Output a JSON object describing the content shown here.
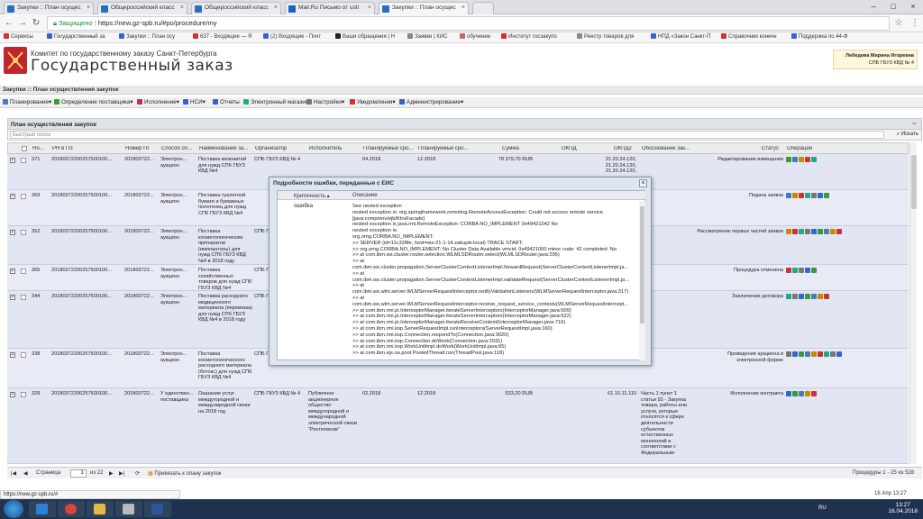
{
  "browser": {
    "tabs": [
      {
        "label": "Закупки :: План осущес",
        "color": "#2d6cc0",
        "active": false
      },
      {
        "label": "Общероссийский класс",
        "color": "#2d6cc0",
        "active": false
      },
      {
        "label": "Общероссийский класс",
        "color": "#2d6cc0",
        "active": false
      },
      {
        "label": "Mail.Ru Письмо от usti",
        "color": "#1a63c6",
        "active": false
      },
      {
        "label": "Закупки :: План осущес",
        "color": "#2d6cc0",
        "active": true
      },
      {
        "label": "",
        "color": "#ddd",
        "active": false
      }
    ],
    "secure_label": "Защищено",
    "url": "https://new.gz-spb.ru/#po/procedure/my",
    "bookmarks": [
      {
        "label": "Сервисы",
        "color": "#c33"
      },
      {
        "label": "Государственный за",
        "color": "#36c"
      },
      {
        "label": "Закупки :: План осу",
        "color": "#36c"
      },
      {
        "label": "637 - Входящие — Я",
        "color": "#c33"
      },
      {
        "label": "(2) Входящие - Почт",
        "color": "#36c"
      },
      {
        "label": "Ваши обращения | Н",
        "color": "#222"
      },
      {
        "label": "Заявки | КИС",
        "color": "#888"
      },
      {
        "label": "обучение",
        "color": "#c66"
      },
      {
        "label": "Институт госзакупо",
        "color": "#c33"
      },
      {
        "label": "Реестр товаров для",
        "color": "#888"
      },
      {
        "label": "НПД «Закон Санкт-П",
        "color": "#36c"
      },
      {
        "label": "Справочник конечн",
        "color": "#c33"
      },
      {
        "label": "Поддержка по 44-Ф",
        "color": "#36c"
      }
    ]
  },
  "site": {
    "subtitle": "Комитет по государственному заказу Санкт-Петербурга",
    "title": "Государственный заказ",
    "user_name": "Лебедева Марина Игоревна",
    "user_org": "СПБ ГБУЗ КВД № 4"
  },
  "breadcrumb": "Закупки :: План осуществления закупок",
  "menu": [
    {
      "label": "Планирование",
      "color": "#4a7bb7"
    },
    {
      "label": "Определение поставщика",
      "color": "#3a9a3a"
    },
    {
      "label": "Исполнение",
      "color": "#b35"
    },
    {
      "label": "НСИ",
      "color": "#36c"
    },
    {
      "label": "Отчеты",
      "color": "#36c"
    },
    {
      "label": "Электронный магазин",
      "color": "#2a8"
    },
    {
      "label": "Настройки",
      "color": "#777"
    },
    {
      "label": "Уведомления",
      "color": "#c33"
    },
    {
      "label": "Администрирование",
      "color": "#36c"
    }
  ],
  "panel": {
    "title": "План осуществления закупок",
    "search_placeholder": "Быстрый поиск",
    "search_button": "Искать"
  },
  "columns": [
    "Но...",
    "РН в ПЗ",
    "Номер ПГ",
    "Способ оп...",
    "Наименование за...",
    "Организатор",
    "Исполнитель",
    "Планируемый сро...",
    "Планируемый сро...",
    "Сумма",
    "ОКПД",
    "ОКПД2",
    "Обоснование зак...",
    "Статус",
    "Операции"
  ],
  "rows": [
    {
      "no": "371",
      "rn": "20180372200257500100...",
      "pg": "201803722...",
      "method": "Электрон... аукцион",
      "name": "Поставка мезонитей для нужд СПб ГБУЗ КВД №4",
      "org": "СПБ ГБУЗ КВД № 4",
      "exec": "",
      "d1": "04.2018",
      "d2": "12.2018",
      "sum": "78 379,70 RUB",
      "okpd": "",
      "okpd2": "21.20.24.120, 21.20.24.120, 21.20.24.120,",
      "reason": "",
      "status": "Редактирование извещения"
    },
    {
      "no": "369",
      "rn": "20180372200257500100...",
      "pg": "201803722...",
      "method": "Электрон... аукцион",
      "name": "Поставка туалетной бумаги и бумажных полотенец для нужд СПб ГБУЗ КВД №4",
      "org": "",
      "exec": "",
      "d1": "",
      "d2": "",
      "sum": "",
      "okpd": "",
      "okpd2": "",
      "reason": "",
      "status": "Подача заявок"
    },
    {
      "no": "352",
      "rn": "20180372200257500100...",
      "pg": "201803722...",
      "method": "Электрон... аукцион",
      "name": "Поставка косметологических препаратов (имплантаты) для нужд СПб ГБУЗ КВД №4 в 2018 году",
      "org": "СПБ Г",
      "exec": "",
      "d1": "",
      "d2": "",
      "sum": "",
      "okpd": "",
      "okpd2": "",
      "reason": "",
      "status": "Рассмотрение первых частей заявок"
    },
    {
      "no": "365",
      "rn": "20180372200257500100...",
      "pg": "201803722...",
      "method": "Электрон... аукцион",
      "name": "Поставка хозяйственных товаров для нужд СПб ГБУЗ КВД №4",
      "org": "СПБ Г",
      "exec": "",
      "d1": "",
      "d2": "",
      "sum": "",
      "okpd": "",
      "okpd2": "",
      "reason": "",
      "status": "Процедура отменена"
    },
    {
      "no": "344",
      "rn": "20180372200257500100...",
      "pg": "201803722...",
      "method": "Электрон... аукцион",
      "name": "Поставка расходного медицинского материала (перевязка) для нужд СПб ГБУЗ КВД №4 в 2018 году",
      "org": "СПБ Г",
      "exec": "",
      "d1": "",
      "d2": "",
      "sum": "",
      "okpd": "",
      "okpd2": "",
      "reason": "",
      "status": "Заключение договора"
    },
    {
      "no": "338",
      "rn": "20180372200257500100...",
      "pg": "201803722...",
      "method": "Электрон... аукцион",
      "name": "Поставка косметологического расходного материала (ботокс) для нужд СПб ГБУЗ КВД №4",
      "org": "СПБ Г",
      "exec": "",
      "d1": "",
      "d2": "",
      "sum": "",
      "okpd": "",
      "okpd2": "",
      "reason": "",
      "status": "Проведение аукциона в электронной форме"
    },
    {
      "no": "329",
      "rn": "20180372200257500100...",
      "pg": "201803722...",
      "method": "У единствен... поставщика",
      "name": "Оказание услуг междугородной и международной связи на 2018 год",
      "org": "СПБ ГБУЗ КВД № 4",
      "exec": "Публичное акционерное общество междугородной и международной электрической связи \"Ростелеком\"",
      "d1": "02.2018",
      "d2": "12.2018",
      "sum": "523,20 RUB",
      "okpd": "",
      "okpd2": "61.10.11.110",
      "reason": "Часть 1 пункт 1 статьи 93 - Закупка товара, работы или услуги, которые относятся к сфере деятельности субъектов естественных монополий в соответствии с Федеральным",
      "status": "Исполнение контракта"
    }
  ],
  "pager": {
    "page_label": "Страница",
    "page_value": "1",
    "of_label": "из 22",
    "link_label": "Привязать к плану закупок",
    "summary": "Процедуры 1 - 25 из 528"
  },
  "modal": {
    "title": "Подробности ошибки, переданные с ЕИС",
    "col_severity": "Критичность",
    "col_description": "Описание",
    "severity": "ошибка",
    "description": "See nested exception\nnested exception is: org.springframework.remoting.RemoteAccessException: Could not access remote service [java:comp/env/ejb/KtruFacade]\nnested exception is java.rmi.RemoteException: CORBA NO_IMPLEMENT 0x49421042 No\nnested exception is:\norg.omg.CORBA.NO_IMPLEMENT:\n>> SERVER (id=11c328fe, host=eis-21-1-14.zakupki.local) TRACE START:\n>> org.omg.CORBA.NO_IMPLEMENT: No Cluster Data Available vmcid: 0x49421000 minor code: 42 completed: No\n>> at com.ibm.ws.cluster.router.selection.WLMLSDRouter.select(WLMLSDRouter.java:295)\n>> at\ncom.ibm.ws.cluster.propagation.ServerClusterContextListenerImpl.forwardRequest(ServerClusterContextListenerImpl.ja...\n>> at\ncom.ibm.ws.cluster.propagation.ServerClusterContextListenerImpl.validateRequest(ServerClusterContextListenerImpl.ja...\n>> at\ncom.ibm.ws.wlm.server.WLMServerRequestInterceptor.notifyValidationListeners(WLMServerRequestInterceptor.java:317)\n>> at\ncom.ibm.ws.wlm.server.WLMServerRequestInterceptor.receive_request_service_contexts(WLMServerRequestIntercept...\n>> at com.ibm.rmi.pi.InterceptorManager.iterateServerInterceptors(InterceptorManager.java:609)\n>> at com.ibm.rmi.pi.InterceptorManager.iterateServerInterceptors(InterceptorManager.java:522)\n>> at com.ibm.rmi.pi.InterceptorManager.iterateReceiveContext(InterceptorManager.java:716)\n>> at com.ibm.rmi.iiop.ServerRequestImpl.runInterceptors(ServerRequestImpl.java:160)\n>> at com.ibm.rmi.iiop.Connection.respondTo(Connection.java:3020)\n>> at com.ibm.rmi.iiop.Connection.doWork(Connection.java:2931)\n>> at com.ibm.rmi.iiop.WorkUnitImpl.doWork(WorkUnitImpl.java:65)\n>> at com.ibm.ejs.oa.pool.PooledThread.run(ThreadPool.java:118)"
  },
  "status_url": "https://new.gz-spb.ru/#",
  "datestamp": "16 Апр 13:27",
  "taskbar": {
    "lang": "RU",
    "time": "13:27",
    "date": "16.04.2018"
  }
}
